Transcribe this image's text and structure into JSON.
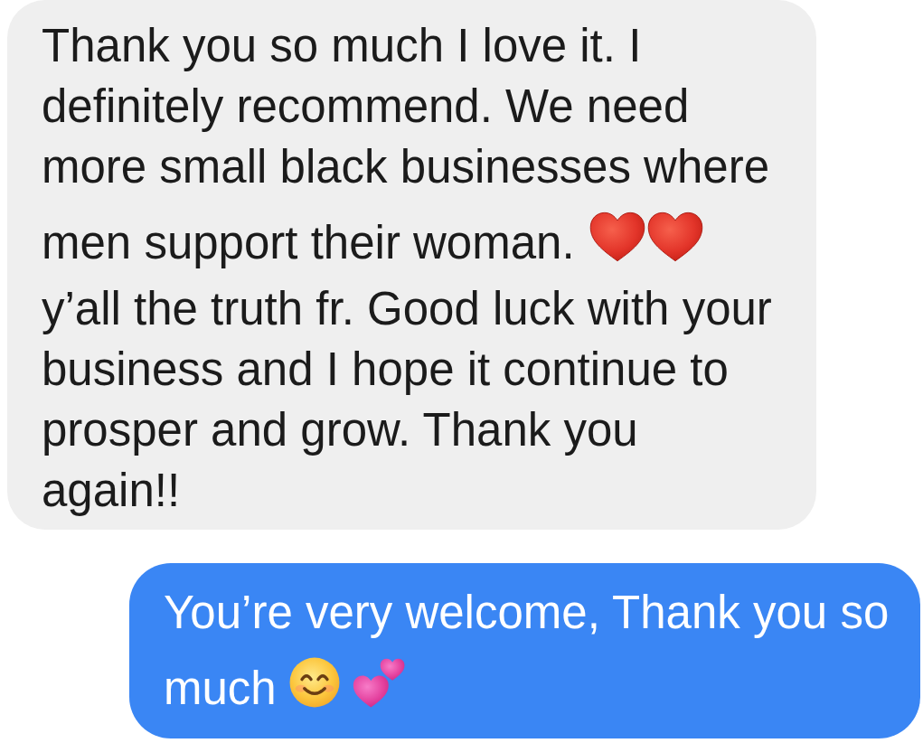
{
  "messages": [
    {
      "kind": "received",
      "parts": [
        {
          "kind": "text",
          "text": "Thank you so much I love it. I definitely recommend. We need more small black businesses where"
        },
        {
          "kind": "text",
          "text": "men support their woman."
        },
        {
          "kind": "heart"
        },
        {
          "kind": "heart"
        },
        {
          "kind": "text",
          "text": "y’all the truth fr. Good luck with your business and I hope it continue to prosper and grow. Thank you again!!"
        }
      ]
    },
    {
      "kind": "sent",
      "parts": [
        {
          "kind": "text",
          "text": "You’re very welcome, Thank you so"
        },
        {
          "kind": "text",
          "text": "much"
        },
        {
          "kind": "smiley"
        },
        {
          "kind": "hearts"
        }
      ]
    }
  ]
}
